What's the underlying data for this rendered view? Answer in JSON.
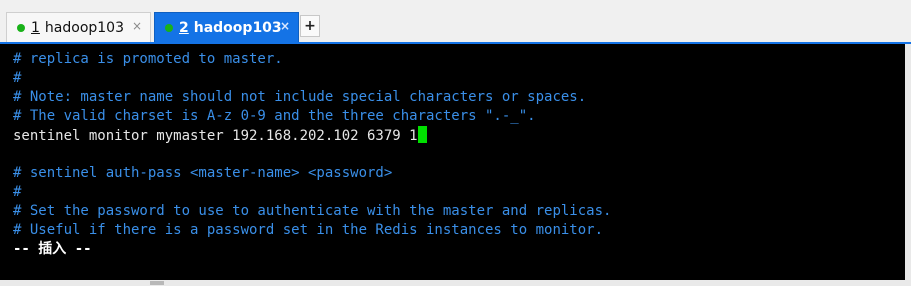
{
  "tabs": [
    {
      "number": "1",
      "label": "hadoop103",
      "close": "×",
      "active": false
    },
    {
      "number": "2",
      "label": "hadoop103",
      "close": "×",
      "active": true
    }
  ],
  "add_tab": "+",
  "terminal": {
    "lines": [
      "# replica is promoted to master.",
      "#",
      "# Note: master name should not include special characters or spaces.",
      "# The valid charset is A-z 0-9 and the three characters \".-_\".",
      "sentinel monitor mymaster 192.168.202.102 6379 1",
      "",
      "# sentinel auth-pass <master-name> <password>",
      "#",
      "# Set the password to use to authenticate with the master and replicas.",
      "# Useful if there is a password set in the Redis instances to monitor.",
      "-- 插入 --"
    ]
  },
  "colors": {
    "comment": "#3a8fe8",
    "text": "#e6e6e6",
    "cursor": "#00e000",
    "active_tab": "#1473e6",
    "status_dot": "#19b219"
  },
  "icons": {
    "tab_status": "green-dot-icon",
    "close": "close-icon",
    "add": "plus-icon"
  }
}
